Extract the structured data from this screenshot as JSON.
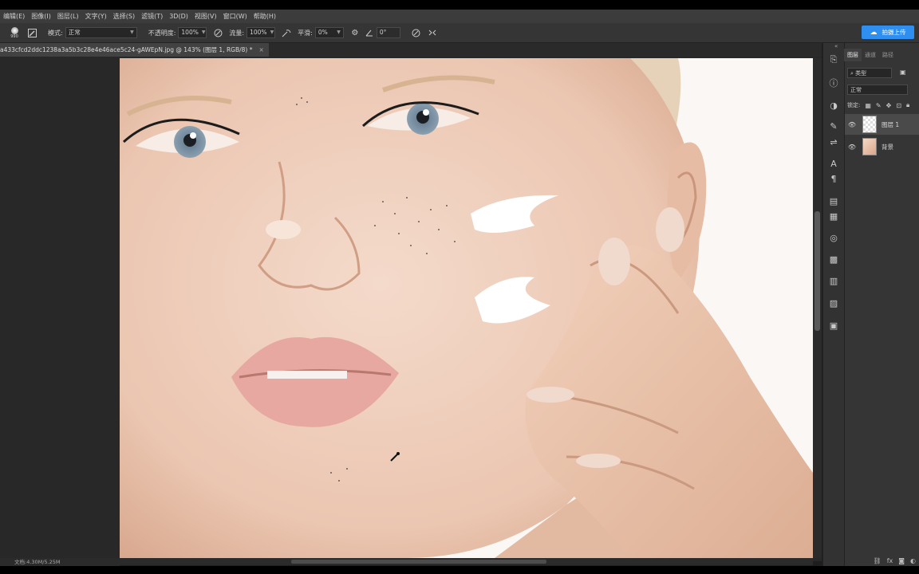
{
  "menu": [
    "编辑(E)",
    "图像(I)",
    "图层(L)",
    "文字(Y)",
    "选择(S)",
    "滤镜(T)",
    "3D(D)",
    "视图(V)",
    "窗口(W)",
    "帮助(H)"
  ],
  "options": {
    "brush_size": "990",
    "mode_label": "模式:",
    "mode_value": "正常",
    "opacity_label": "不透明度:",
    "opacity_value": "100%",
    "flow_label": "流量:",
    "flow_value": "100%",
    "smooth_label": "平滑:",
    "smooth_value": "0%",
    "angle_value": "0°",
    "cloud_button": "拍摄上传"
  },
  "document": {
    "tab_title": "a433cfcd2ddc1238a3a5b3c28e4e46ace5c24-gAWEpN.jpg @ 143% (图层 1, RGB/8) *",
    "status": "文档:4.30M/5.25M"
  },
  "layers_panel": {
    "tabs": [
      "图层",
      "通道",
      "路径"
    ],
    "active_tab": "图层",
    "filter": "类型",
    "blend_mode": "正常",
    "lock_label": "锁定:",
    "layers": [
      {
        "name": "图层 1",
        "selected": true,
        "visible": true
      },
      {
        "name": "背景",
        "selected": false,
        "visible": true
      }
    ]
  },
  "colors": {
    "ui_dark": "#353535",
    "accent_button": "#2e8ff0",
    "photo_background": "#fbf7f4"
  }
}
